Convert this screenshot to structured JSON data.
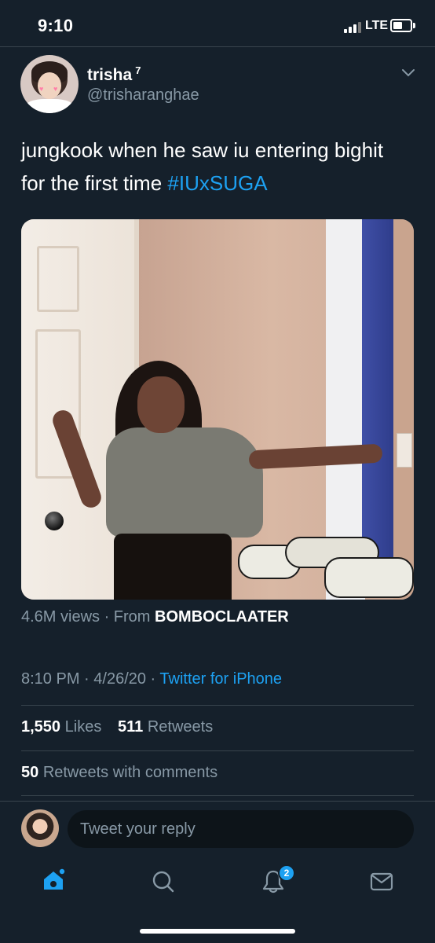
{
  "status_bar": {
    "time": "9:10",
    "network": "LTE",
    "signal_icon": "signal-bars-icon",
    "battery_icon": "battery-icon"
  },
  "tweet": {
    "display_name": "trisha",
    "name_superscript": "7",
    "handle": "@trisharanghae",
    "text": "jungkook when he saw iu entering bighit for the first time ",
    "hashtag": "#IUxSUGA",
    "media": {
      "views_count": "4.6M views",
      "views_separator": " · From ",
      "source_account": "BOMBOCLAATER"
    },
    "timestamp": {
      "time": "8:10 PM",
      "separator": " · ",
      "date": "4/26/20",
      "client": "Twitter for iPhone"
    },
    "stats": {
      "likes_count": "1,550",
      "likes_label": "Likes",
      "retweets_count": "511",
      "retweets_label": "Retweets",
      "quote_count": "50",
      "quote_label": "Retweets with comments"
    }
  },
  "reply": {
    "placeholder": "Tweet your reply"
  },
  "tab_bar": {
    "items": [
      {
        "name": "home",
        "icon": "home-icon",
        "active": true
      },
      {
        "name": "search",
        "icon": "search-icon",
        "active": false
      },
      {
        "name": "notifications",
        "icon": "bell-icon",
        "badge": "2",
        "active": false
      },
      {
        "name": "messages",
        "icon": "mail-icon",
        "active": false
      }
    ]
  },
  "colors": {
    "background": "#15202b",
    "accent": "#1da1f2",
    "secondary_text": "#8899a6",
    "divider": "#38444d"
  }
}
